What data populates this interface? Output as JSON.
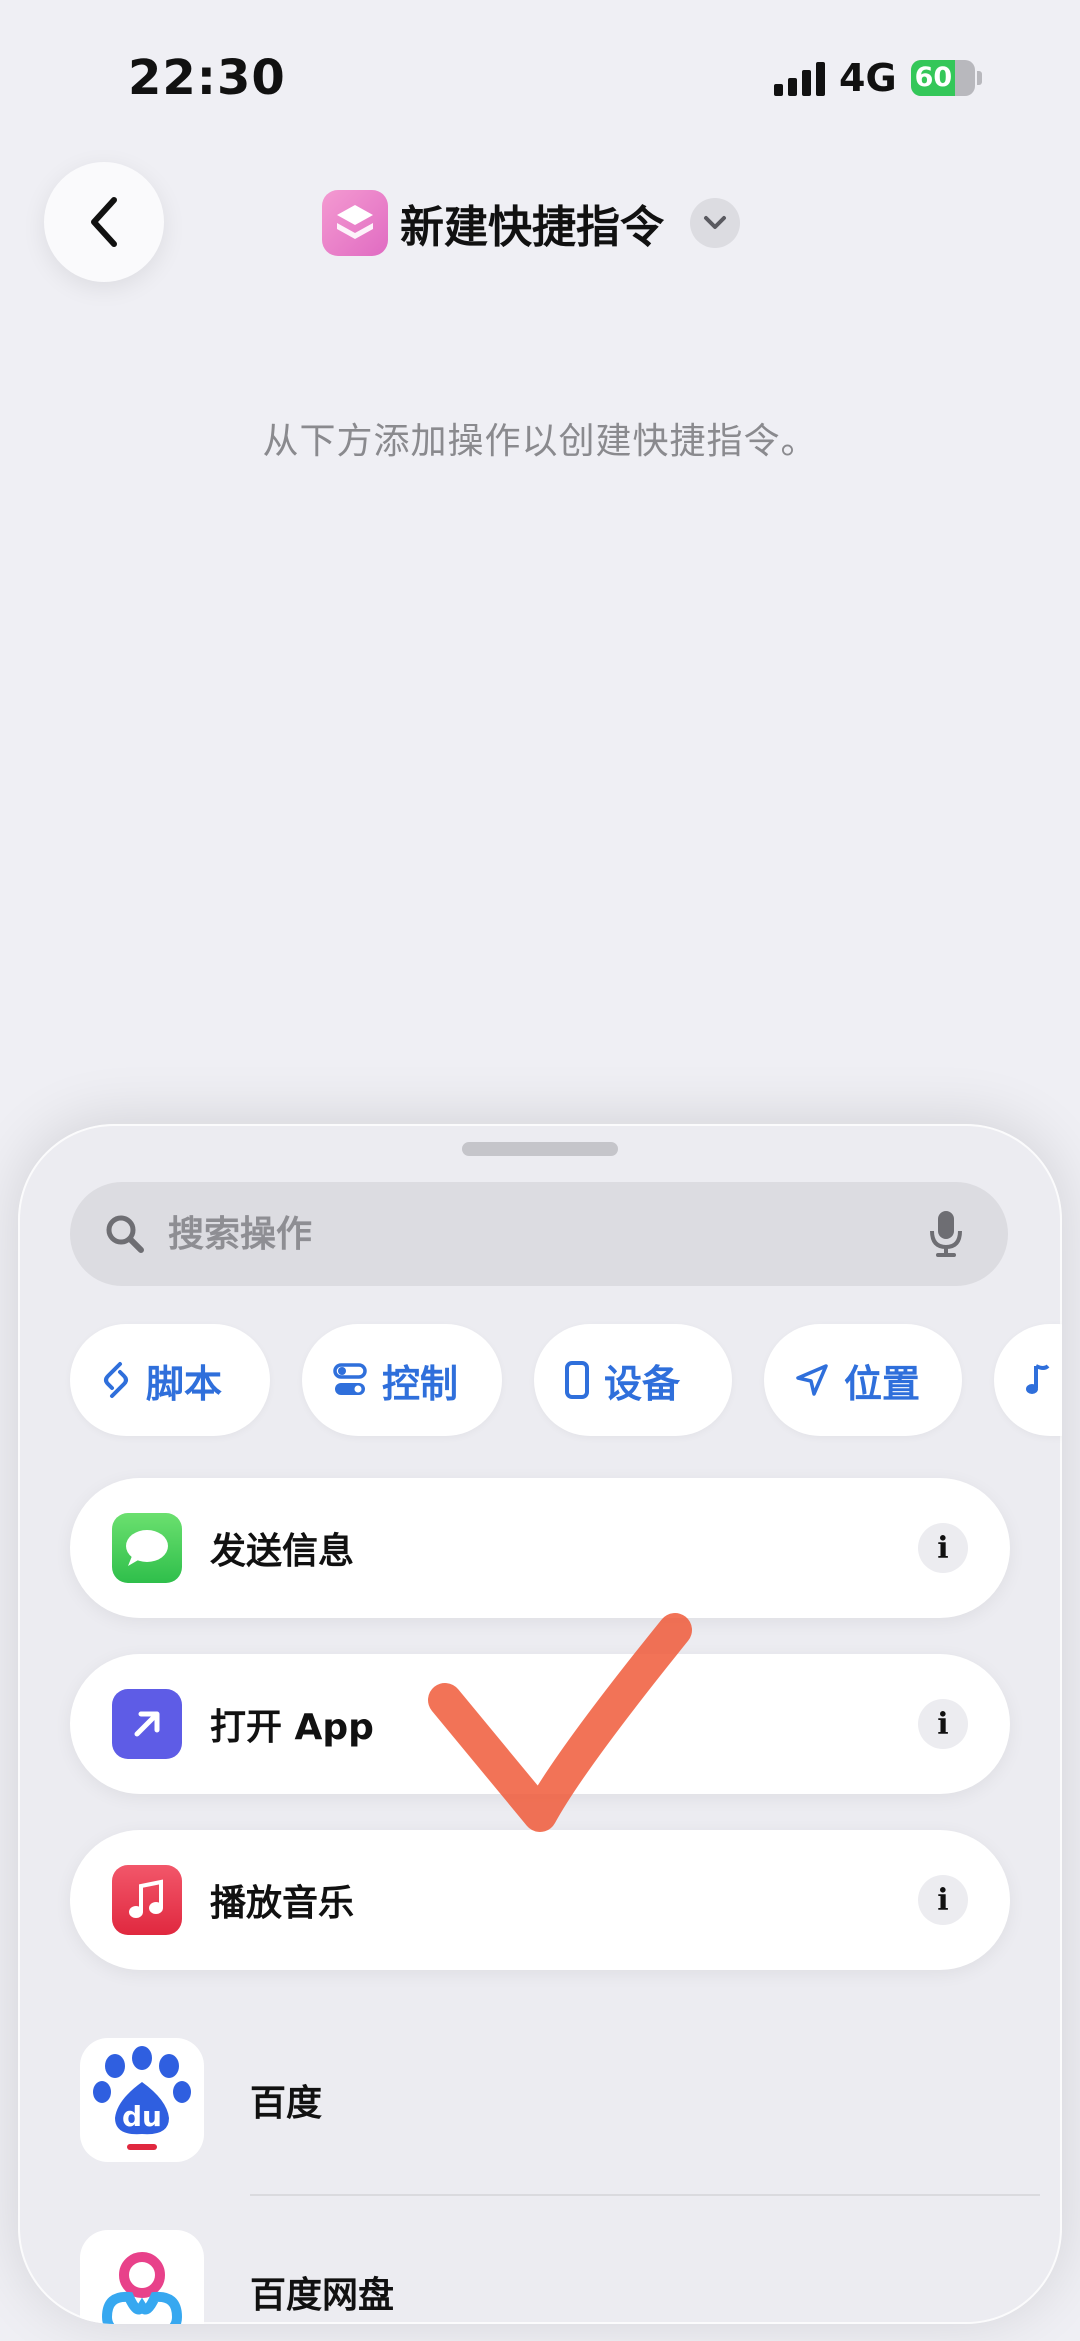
{
  "status_bar": {
    "time": "22:30",
    "network": "4G",
    "battery": "60"
  },
  "nav": {
    "title": "新建快捷指令"
  },
  "hint": "从下方添加操作以创建快捷指令。",
  "search": {
    "placeholder": "搜索操作"
  },
  "chips": [
    {
      "label": "脚本"
    },
    {
      "label": "控制"
    },
    {
      "label": "设备"
    },
    {
      "label": "位置"
    }
  ],
  "actions": [
    {
      "label": "发送信息",
      "icon": "messages-icon",
      "color": "#34c759"
    },
    {
      "label": "打开 App",
      "icon": "arrow-up-right-icon",
      "color": "#5e5ce6"
    },
    {
      "label": "播放音乐",
      "icon": "music-note-icon",
      "color": "#ef3f52"
    }
  ],
  "apps": [
    {
      "label": "百度"
    },
    {
      "label": "百度网盘"
    }
  ],
  "annotation": {
    "icon": "checkmark",
    "color": "#f05a3a"
  },
  "accent_color": "#2f6fdb"
}
